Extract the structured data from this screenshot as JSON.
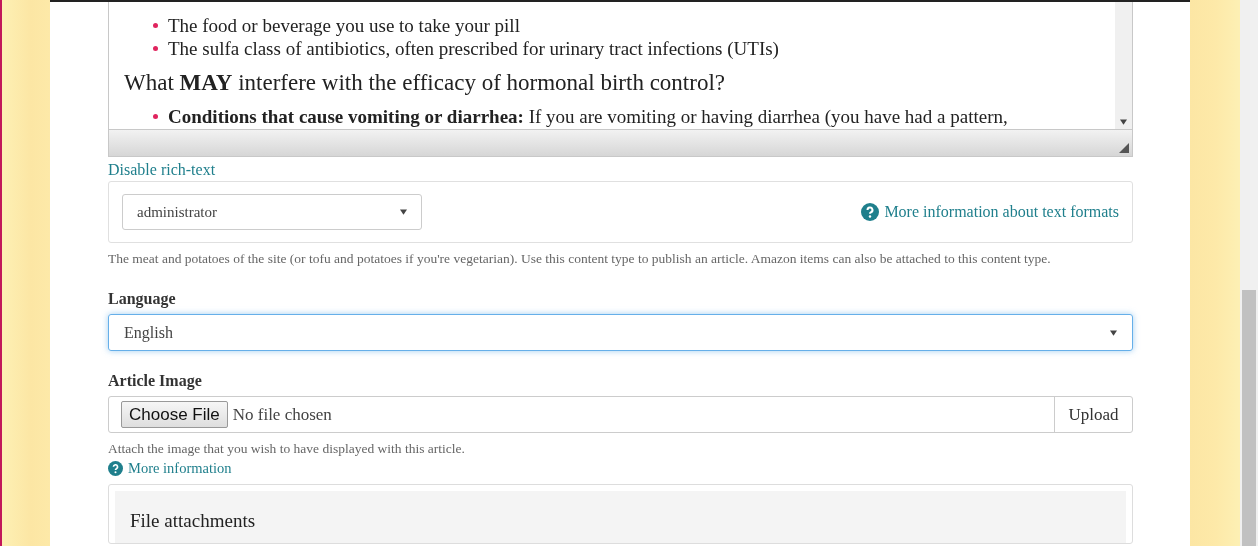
{
  "editor": {
    "list_top": [
      "The food or beverage you use to take your pill",
      "The sulfa class of antibiotics, often prescribed for urinary tract infections (UTIs)"
    ],
    "heading": "What **MAY** interfere with the efficacy of hormonal birth control?",
    "list_bottom": [
      "**Conditions that cause vomiting or diarrhea:** If you are vomiting or having diarrhea (you have had a pattern,"
    ]
  },
  "disable_link": "Disable rich-text",
  "text_format": {
    "value": "administrator",
    "help_link": "More information about text formats"
  },
  "description": "The meat and potatoes of the site (or tofu and potatoes if you're vegetarian). Use this content type to publish an article. Amazon items can also be attached to this content type.",
  "language": {
    "label": "Language",
    "value": "English",
    "focused": true
  },
  "article_image": {
    "label": "Article Image",
    "choose_button": "Choose File",
    "file_status": "No file chosen",
    "upload_button": "Upload",
    "help": "Attach the image that you wish to have displayed with this article.",
    "more_link": "More information"
  },
  "attachments": {
    "title": "File attachments"
  }
}
